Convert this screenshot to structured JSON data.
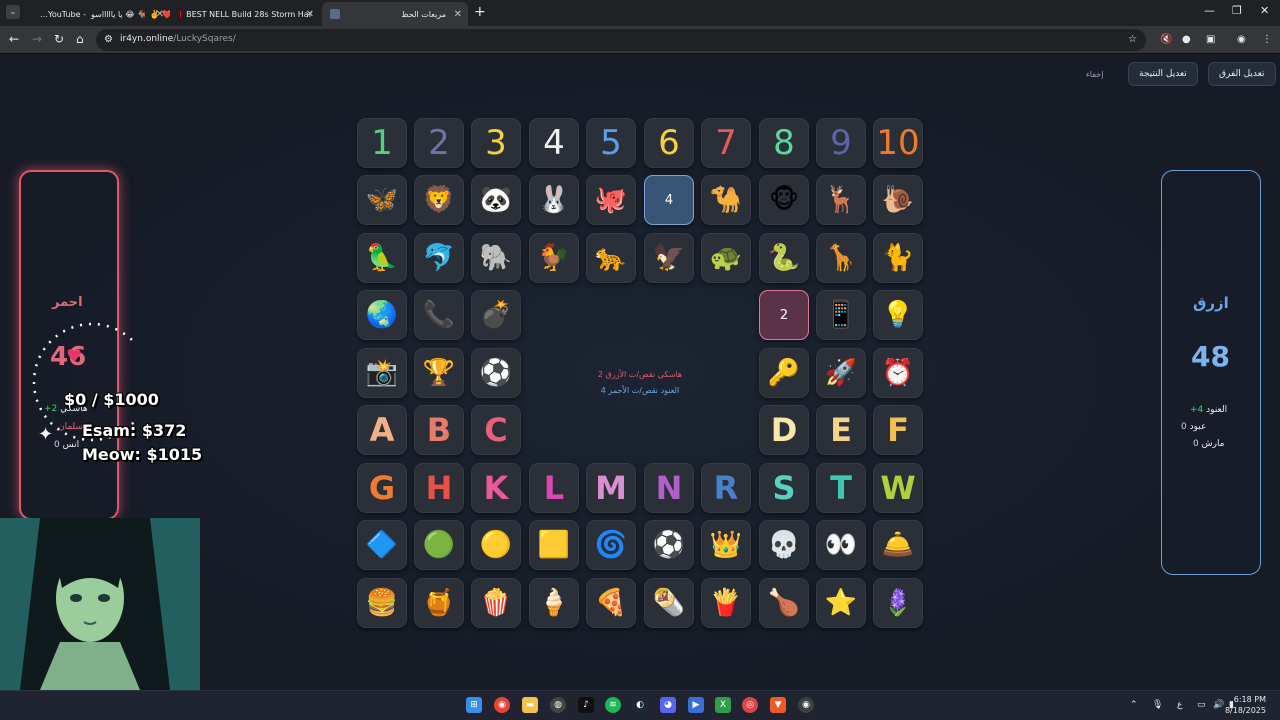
{
  "browser": {
    "tabs": [
      {
        "title": "…YouTube - ‎ يا ياااااسو 😂 🐐 ✌️ ❤️",
        "active": false,
        "icon": "youtube-icon"
      },
      {
        "title": "BEST NELL Build 28s Storm Har",
        "active": false,
        "icon": "youtube-icon"
      },
      {
        "title": "مربعات الحظ",
        "active": true,
        "icon": "page-icon"
      }
    ],
    "url_host": "ir4yn.online",
    "url_path": "/LuckySqares/",
    "clock_time": "6:18 PM",
    "clock_date": "8/18/2025",
    "lang": "ع"
  },
  "header_buttons": {
    "edit_teams": "تعديل الفرق",
    "edit_score": "تعديل النتيجة",
    "hide": "إخفاء"
  },
  "grid": {
    "row1": [
      {
        "t": "1",
        "c": "#4fd17f"
      },
      {
        "t": "2",
        "c": "#6e74a8"
      },
      {
        "t": "3",
        "c": "#f3d43c"
      },
      {
        "t": "4",
        "c": "#f0f0f0"
      },
      {
        "t": "5",
        "c": "#5aa0e8"
      },
      {
        "t": "6",
        "c": "#f5d23a"
      },
      {
        "t": "7",
        "c": "#e85a5a"
      },
      {
        "t": "8",
        "c": "#5ad79a"
      },
      {
        "t": "9",
        "c": "#5c64a8"
      },
      {
        "t": "10",
        "c": "#f07a2a"
      }
    ],
    "row2": [
      "🦋",
      "🦁",
      "🐼",
      "🐰",
      "🐙",
      "4",
      "🐪",
      "🐵",
      "🦌",
      "🐌"
    ],
    "row3": [
      "🦜",
      "🐬",
      "🐘",
      "🐓",
      "🐆",
      "🦅",
      "🐢",
      "🐍",
      "🦒",
      "🐈"
    ],
    "row4": [
      "🌏",
      "📞",
      "💣",
      "2",
      "📱",
      "💡"
    ],
    "row5": [
      "📸",
      "🏆",
      "⚽",
      "🔑",
      "🚀",
      "⏰"
    ],
    "row6": [
      {
        "t": "A",
        "c": "#f2b08a"
      },
      {
        "t": "B",
        "c": "#e87a6a"
      },
      {
        "t": "C",
        "c": "#e8607a"
      },
      {
        "t": "D",
        "c": "#f6e8a8"
      },
      {
        "t": "E",
        "c": "#f4d48a"
      },
      {
        "t": "F",
        "c": "#f0c050"
      }
    ],
    "row7": [
      {
        "t": "G",
        "c": "#f07a30"
      },
      {
        "t": "H",
        "c": "#e8504a"
      },
      {
        "t": "K",
        "c": "#e85a9a"
      },
      {
        "t": "L",
        "c": "#d84ab0"
      },
      {
        "t": "M",
        "c": "#d890d0"
      },
      {
        "t": "N",
        "c": "#b060c8"
      },
      {
        "t": "R",
        "c": "#4a80c8"
      },
      {
        "t": "S",
        "c": "#5ad0c0"
      },
      {
        "t": "T",
        "c": "#3ec8b0"
      },
      {
        "t": "W",
        "c": "#b0d040"
      }
    ],
    "row8": [
      "🔷",
      "🟢",
      "🟡",
      "🟨",
      "🌀",
      "⚽",
      "👑",
      "💀",
      "👀",
      "🛎️"
    ],
    "row9": [
      "🍔",
      "🍯",
      "🍿",
      "🍦",
      "🍕",
      "🌯",
      "🍟",
      "🍗",
      "⭐",
      "🪻"
    ]
  },
  "messages": {
    "red_line": "هاسكي نقص/ت الأزرق 2",
    "blue_line": "العنود نقص/ت الأحمر 4"
  },
  "team_red": {
    "name": "احمر",
    "score": "46",
    "members": [
      {
        "name": "هاسكي",
        "delta": "+2"
      },
      {
        "name": "سلمان",
        "delta": ""
      },
      {
        "name": "انس",
        "delta": "0"
      }
    ],
    "color": "#e1566e"
  },
  "team_blue": {
    "name": "ازرق",
    "score": "48",
    "members": [
      {
        "name": "العنود",
        "delta": "+4"
      },
      {
        "name": "عبود",
        "delta": "0"
      },
      {
        "name": "مارش",
        "delta": "0"
      }
    ],
    "color": "#6e9fd6"
  },
  "overlay": {
    "goal": "$0 / $1000",
    "donor1": "Esam: $372",
    "donor2": "Meow: $1015"
  }
}
